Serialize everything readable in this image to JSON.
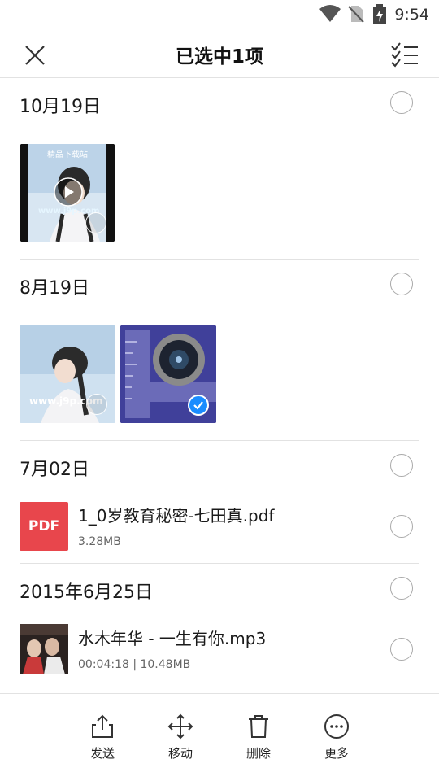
{
  "status_bar": {
    "time": "9:54",
    "icons": [
      "wifi-icon",
      "no-sim-icon",
      "battery-charging-icon"
    ]
  },
  "app_bar": {
    "title": "已选中1项",
    "left_icon": "close-icon",
    "right_icon": "select-all-icon"
  },
  "groups": [
    {
      "date": "10月19日",
      "items": [
        {
          "kind": "video",
          "overlay_text": "精品下载站",
          "watermark": "www.j9p.com",
          "selected": false
        }
      ]
    },
    {
      "date": "8月19日",
      "items": [
        {
          "kind": "image",
          "watermark": "www.j9p.com",
          "selected": false
        },
        {
          "kind": "image",
          "selected": true
        }
      ]
    },
    {
      "date": "7月02日",
      "files": [
        {
          "icon_label": "PDF",
          "name": "1_0岁教育秘密-七田真.pdf",
          "meta": "3.28MB",
          "selected": false
        }
      ]
    },
    {
      "date": "2015年6月25日",
      "files": [
        {
          "icon_label": "",
          "name": "水木年华 - 一生有你.mp3",
          "meta": "00:04:18 | 10.48MB",
          "selected": false
        }
      ]
    }
  ],
  "bottom_bar": [
    {
      "label": "发送",
      "icon": "share-icon"
    },
    {
      "label": "移动",
      "icon": "move-icon"
    },
    {
      "label": "删除",
      "icon": "trash-icon"
    },
    {
      "label": "更多",
      "icon": "more-icon"
    }
  ],
  "colors": {
    "accent": "#1a8cff",
    "pdf_red": "#e8464c",
    "divider": "#e2e2e2",
    "text": "#1a1a1a"
  }
}
